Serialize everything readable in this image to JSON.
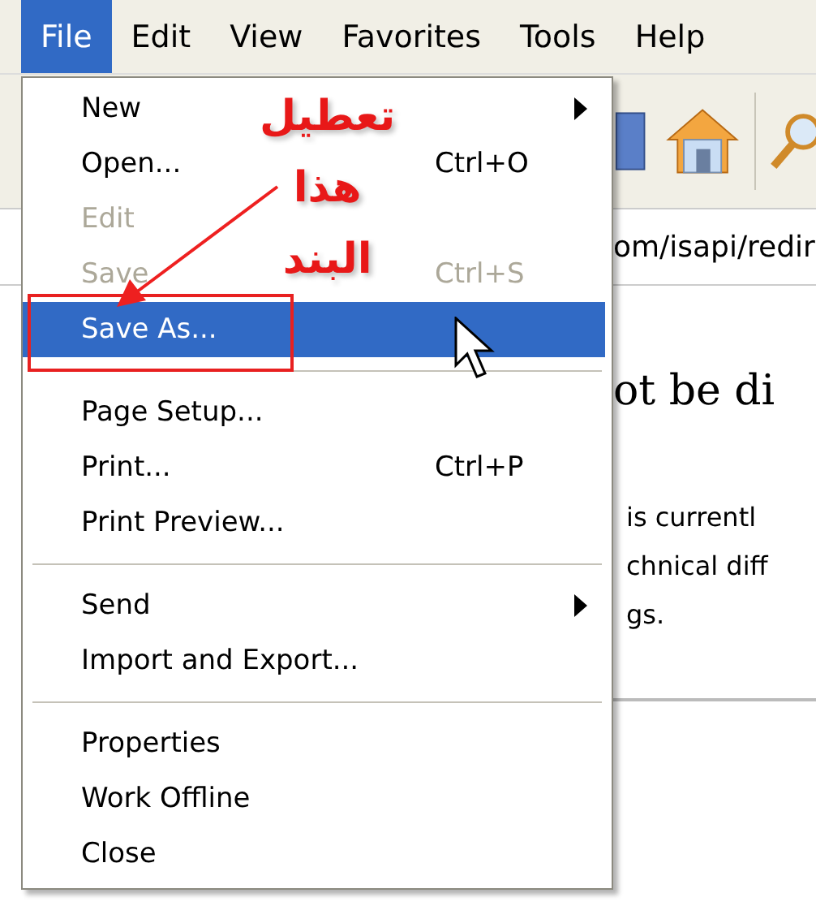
{
  "menu_bar": [
    {
      "label": "File",
      "selected": true
    },
    {
      "label": "Edit",
      "selected": false
    },
    {
      "label": "View",
      "selected": false
    },
    {
      "label": "Favorites",
      "selected": false
    },
    {
      "label": "Tools",
      "selected": false
    },
    {
      "label": "Help",
      "selected": false
    }
  ],
  "address_bar": {
    "value": "om/isapi/redir"
  },
  "page": {
    "heading": "ot be di",
    "lines": [
      "is currentl",
      "chnical diff",
      "gs."
    ]
  },
  "file_menu": [
    {
      "kind": "item",
      "label": "New",
      "submenu": true,
      "disabled": false,
      "selected": false
    },
    {
      "kind": "item",
      "label": "Open...",
      "shortcut": "Ctrl+O",
      "disabled": false,
      "selected": false
    },
    {
      "kind": "item",
      "label": "Edit",
      "disabled": true,
      "selected": false
    },
    {
      "kind": "item",
      "label": "Save",
      "shortcut": "Ctrl+S",
      "disabled": true,
      "selected": false
    },
    {
      "kind": "item",
      "label": "Save As...",
      "disabled": false,
      "selected": true
    },
    {
      "kind": "separator"
    },
    {
      "kind": "item",
      "label": "Page Setup...",
      "disabled": false,
      "selected": false
    },
    {
      "kind": "item",
      "label": "Print...",
      "shortcut": "Ctrl+P",
      "disabled": false,
      "selected": false
    },
    {
      "kind": "item",
      "label": "Print Preview...",
      "disabled": false,
      "selected": false
    },
    {
      "kind": "separator"
    },
    {
      "kind": "item",
      "label": "Send",
      "submenu": true,
      "disabled": false,
      "selected": false
    },
    {
      "kind": "item",
      "label": "Import and Export...",
      "disabled": false,
      "selected": false
    },
    {
      "kind": "separator"
    },
    {
      "kind": "item",
      "label": "Properties",
      "disabled": false,
      "selected": false
    },
    {
      "kind": "item",
      "label": "Work Offline",
      "disabled": false,
      "selected": false
    },
    {
      "kind": "item",
      "label": "Close",
      "disabled": false,
      "selected": false
    }
  ],
  "annotation": {
    "lines": [
      "تعطيل",
      "هذا",
      "البند"
    ]
  }
}
